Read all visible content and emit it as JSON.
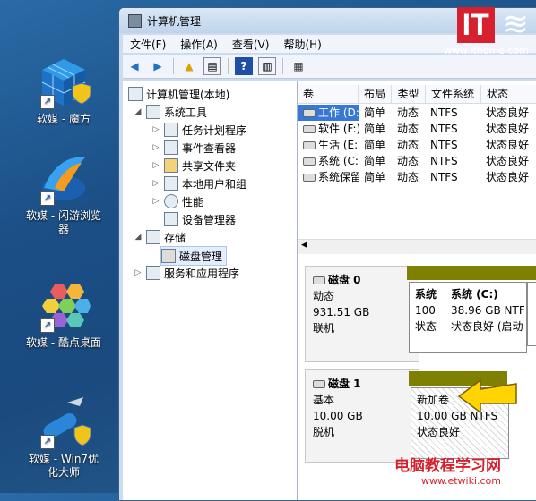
{
  "desktop_icons": [
    {
      "label": "软媒 - 魔方",
      "icon": "cube-icon"
    },
    {
      "label": "软媒 - 闪游浏览器",
      "icon": "bird-icon"
    },
    {
      "label": "软媒 - 酷点桌面",
      "icon": "hexagon-icon"
    },
    {
      "label": "软媒 - Win7优化大师",
      "icon": "swiss-knife-icon"
    }
  ],
  "window": {
    "title": "计算机管理"
  },
  "menu": [
    "文件(F)",
    "操作(A)",
    "查看(V)",
    "帮助(H)"
  ],
  "tree": {
    "root": "计算机管理(本地)",
    "system_tools": "系统工具",
    "items": [
      "任务计划程序",
      "事件查看器",
      "共享文件夹",
      "本地用户和组",
      "性能",
      "设备管理器"
    ],
    "storage": "存储",
    "disk_management": "磁盘管理",
    "services": "服务和应用程序"
  },
  "volume_table": {
    "headers": [
      "卷",
      "布局",
      "类型",
      "文件系统",
      "状态"
    ],
    "rows": [
      [
        "工作 (D:)",
        "简单",
        "动态",
        "NTFS",
        "状态良好"
      ],
      [
        "软件 (F:)",
        "简单",
        "动态",
        "NTFS",
        "状态良好"
      ],
      [
        "生活 (E:)",
        "简单",
        "动态",
        "NTFS",
        "状态良好"
      ],
      [
        "系统 (C:)",
        "简单",
        "动态",
        "NTFS",
        "状态良好"
      ],
      [
        "系统保留",
        "简单",
        "动态",
        "NTFS",
        "状态良好"
      ]
    ]
  },
  "disk0": {
    "name": "磁盘 0",
    "type": "动态",
    "size": "931.51 GB",
    "status": "联机",
    "parts": [
      {
        "name": "系统",
        "l2": "100",
        "l3": "状态"
      },
      {
        "name": "系统 (C:)",
        "l2": "38.96 GB NTF",
        "l3": "状态良好 (启动"
      }
    ]
  },
  "disk1": {
    "name": "磁盘 1",
    "type": "基本",
    "size": "10.00 GB",
    "status": "脱机",
    "part": {
      "name": "新加卷",
      "l2": "10.00 GB NTFS",
      "l3": "状态良好"
    }
  },
  "logo": {
    "brand": "IT",
    "text": "www.ithome.com"
  },
  "watermark": {
    "title": "电脑教程学习网",
    "url": "www.etwiki.com"
  },
  "colors": {
    "accent": "#ffd400",
    "partition_bar": "#7f7f00",
    "logo_red": "#d7202e"
  }
}
